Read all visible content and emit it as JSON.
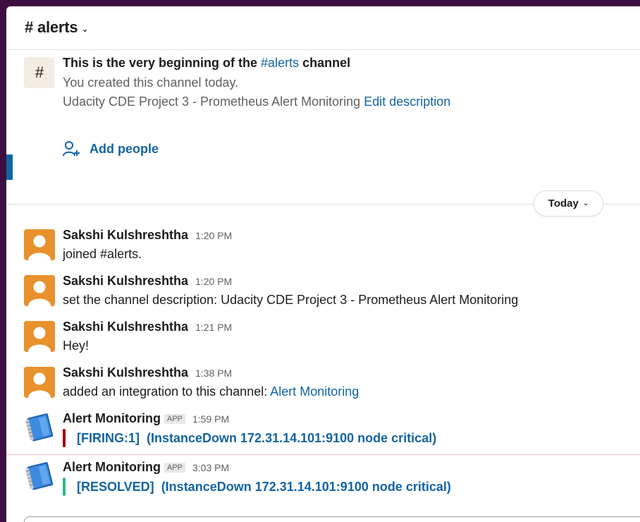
{
  "header": {
    "channel_name": "# alerts",
    "dropdown_icon": "chevron-down-icon"
  },
  "intro": {
    "icon": "#",
    "title_prefix": "This is the very beginning of the",
    "title_channel": "#alerts",
    "title_suffix": "channel",
    "subtitle": "You created this channel today.",
    "description": "Udacity CDE Project 3 - Prometheus Alert Monitoring",
    "edit_description": "Edit description",
    "add_people": "Add people"
  },
  "divider": {
    "label": "Today"
  },
  "messages": [
    {
      "sender": "Sakshi Kulshreshtha",
      "time": "1:20 PM",
      "text": "joined #alerts."
    },
    {
      "sender": "Sakshi Kulshreshtha",
      "time": "1:20 PM",
      "text": "set the channel description: Udacity CDE Project 3 - Prometheus Alert Monitoring"
    },
    {
      "sender": "Sakshi Kulshreshtha",
      "time": "1:21 PM",
      "text": "Hey!"
    },
    {
      "sender": "Sakshi Kulshreshtha",
      "time": "1:38 PM",
      "text": "added an integration to this channel:",
      "link": "Alert Monitoring"
    },
    {
      "sender": "Alert Monitoring",
      "badge": "APP",
      "time": "1:59 PM",
      "status": "[FIRING:1]",
      "detail": "(InstanceDown 172.31.14.101:9100 node critical)",
      "color": "#a30200"
    },
    {
      "sender": "Alert Monitoring",
      "badge": "APP",
      "time": "3:03 PM",
      "status": "[RESOLVED]",
      "detail": "(InstanceDown 172.31.14.101:9100 node critical)",
      "color": "#2eb886"
    }
  ],
  "colors": {
    "sidebar": "#3f0e40",
    "link": "#1264a3",
    "avatar": "#e8912d"
  }
}
